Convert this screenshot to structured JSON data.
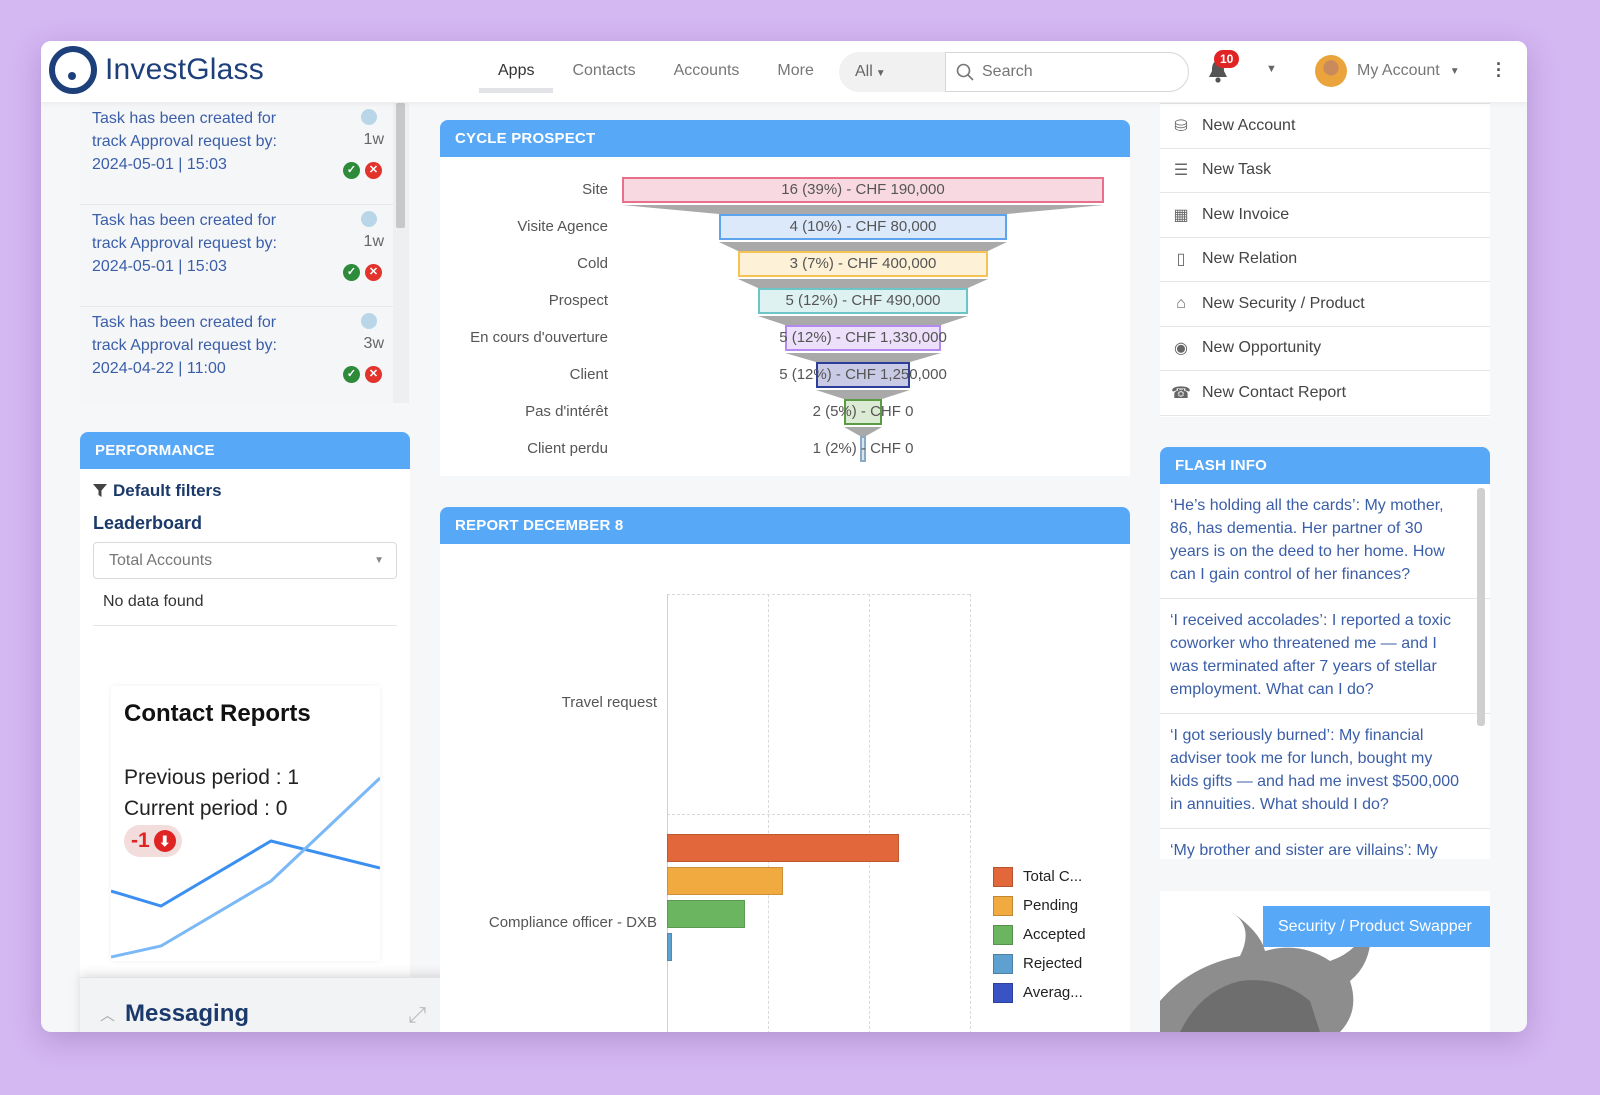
{
  "app": {
    "name": "InvestGlass"
  },
  "header": {
    "nav": [
      {
        "label": "Apps",
        "active": true
      },
      {
        "label": "Contacts",
        "active": false
      },
      {
        "label": "Accounts",
        "active": false
      },
      {
        "label": "More",
        "active": false
      }
    ],
    "scope_selected": "All",
    "search_placeholder": "Search",
    "notifications_count": "10",
    "account_label": "My Account"
  },
  "tasks": [
    {
      "text": "Task has been created for track Approval request by: 2024-05-01 | 15:03",
      "line1": "Task has been created for",
      "line2": "track Approval request by:",
      "line3": "2024-05-01 | 15:03",
      "age": "1w"
    },
    {
      "text": "Task has been created for track Approval request by: 2024-05-01 | 15:03",
      "line1": "Task has been created for",
      "line2": "track Approval request by:",
      "line3": "2024-05-01 | 15:03",
      "age": "1w"
    },
    {
      "text": "Task has been created for track Approval request by: 2024-04-22 | 11:00",
      "line1": "Task has been created for",
      "line2": "track Approval request by:",
      "line3": "2024-04-22 | 11:00",
      "age": "3w"
    }
  ],
  "performance": {
    "title": "PERFORMANCE",
    "filters_label": "Default filters",
    "leaderboard_label": "Leaderboard",
    "leaderboard_selected": "Total Accounts",
    "empty_text": "No data found"
  },
  "contact_reports": {
    "title": "Contact Reports",
    "previous": "Previous period : 1",
    "current": "Current period : 0",
    "delta": "-1",
    "trend": "down"
  },
  "messaging": {
    "title": "Messaging"
  },
  "cycle_prospect": {
    "title": "CYCLE PROSPECT",
    "stages": [
      {
        "name": "Site",
        "label": "16 (39%) - CHF 190,000",
        "count": 16,
        "pct": 39,
        "amount": 190000,
        "fill": "#f9d9e1",
        "stroke": "#e8708a"
      },
      {
        "name": "Visite Agence",
        "label": "4 (10%) - CHF 80,000",
        "count": 4,
        "pct": 10,
        "amount": 80000,
        "fill": "#dbe9fb",
        "stroke": "#5ea4ec"
      },
      {
        "name": "Cold",
        "label": "3 (7%) - CHF 400,000",
        "count": 3,
        "pct": 7,
        "amount": 400000,
        "fill": "#fdf1d8",
        "stroke": "#f3c453"
      },
      {
        "name": "Prospect",
        "label": "5 (12%) - CHF 490,000",
        "count": 5,
        "pct": 12,
        "amount": 490000,
        "fill": "#dff2f2",
        "stroke": "#6cc5c6"
      },
      {
        "name": "En cours d'ouverture",
        "label": "5 (12%) - CHF 1,330,000",
        "count": 5,
        "pct": 12,
        "amount": 1330000,
        "fill": "#ece0fb",
        "stroke": "#b48af0"
      },
      {
        "name": "Client",
        "label": "5 (12%) - CHF 1,250,000",
        "count": 5,
        "pct": 12,
        "amount": 1250000,
        "fill": "#c9cbe6",
        "stroke": "#2c3d9a"
      },
      {
        "name": "Pas d'intérêt",
        "label": "2 (5%) - CHF 0",
        "count": 2,
        "pct": 5,
        "amount": 0,
        "fill": "#dcebd3",
        "stroke": "#5b9b45"
      },
      {
        "name": "Client perdu",
        "label": "1 (2%) - CHF 0",
        "count": 1,
        "pct": 2,
        "amount": 0,
        "fill": "#d8e5ef",
        "stroke": "#8aa9c4"
      }
    ]
  },
  "report": {
    "title": "REPORT DECEMBER 8"
  },
  "chart_data": {
    "type": "bar",
    "orientation": "horizontal",
    "title": "REPORT DECEMBER 8",
    "categories": [
      "Travel request",
      "Compliance officer - DXB"
    ],
    "series": [
      {
        "name": "Total C...",
        "color": "#e2683b",
        "values": [
          0,
          2.3
        ]
      },
      {
        "name": "Pending",
        "color": "#f0aa40",
        "values": [
          0,
          1.15
        ]
      },
      {
        "name": "Accepted",
        "color": "#6cb560",
        "values": [
          0,
          0.77
        ]
      },
      {
        "name": "Rejected",
        "color": "#5ea1d1",
        "values": [
          0,
          0.05
        ]
      },
      {
        "name": "Averag...",
        "color": "#3a53c4",
        "values": [
          0,
          0
        ]
      }
    ],
    "xlim": [
      0,
      3
    ],
    "xticks": [
      0,
      1,
      2,
      3
    ],
    "grid": true,
    "legend": "right"
  },
  "quick_actions": [
    {
      "label": "New Account",
      "icon": "cubes-icon",
      "glyph": "⛁"
    },
    {
      "label": "New Task",
      "icon": "tasks-icon",
      "glyph": "☰"
    },
    {
      "label": "New Invoice",
      "icon": "calculator-icon",
      "glyph": "▦"
    },
    {
      "label": "New Relation",
      "icon": "building-icon",
      "glyph": "▯"
    },
    {
      "label": "New Security / Product",
      "icon": "basket-icon",
      "glyph": "⌂"
    },
    {
      "label": "New Opportunity",
      "icon": "podcast-icon",
      "glyph": "◉"
    },
    {
      "label": "New Contact Report",
      "icon": "phone-icon",
      "glyph": "☎"
    }
  ],
  "flash_info": {
    "title": "FLASH INFO",
    "items": [
      "‘He’s holding all the cards’: My mother, 86, has dementia. Her partner of 30 years is on the deed to her home. How can I gain control of her finances?",
      "‘I received accolades’: I reported a toxic coworker who threatened me — and I was terminated after 7 years of stellar employment. What can I do?",
      "‘I got seriously burned’: My financial adviser took me for lunch, bought my kids gifts — and had me invest $500,000 in annuities. What should I do?",
      "‘My brother and sister are villains’: My"
    ]
  },
  "swapper": {
    "label": "Security / Product Swapper"
  }
}
